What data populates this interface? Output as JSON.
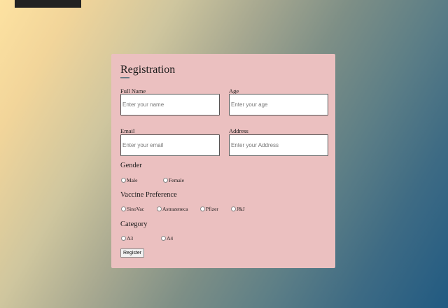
{
  "form": {
    "title": "Registration",
    "fields": {
      "full_name": {
        "label": "Full Name",
        "placeholder": "Enter your name"
      },
      "age": {
        "label": "Age",
        "placeholder": "Enter your age"
      },
      "email": {
        "label": "Email",
        "placeholder": "Enter your email"
      },
      "address": {
        "label": "Address",
        "placeholder": "Enter your Address"
      }
    },
    "gender": {
      "heading": "Gender",
      "options": [
        "Male",
        "Female"
      ]
    },
    "vaccine": {
      "heading": "Vaccine Preference",
      "options": [
        "SinoVac",
        "Astrazeneca",
        "Pfizer",
        "J&J"
      ]
    },
    "category": {
      "heading": "Category",
      "options": [
        "A3",
        "A4"
      ]
    },
    "submit_label": "Register"
  }
}
